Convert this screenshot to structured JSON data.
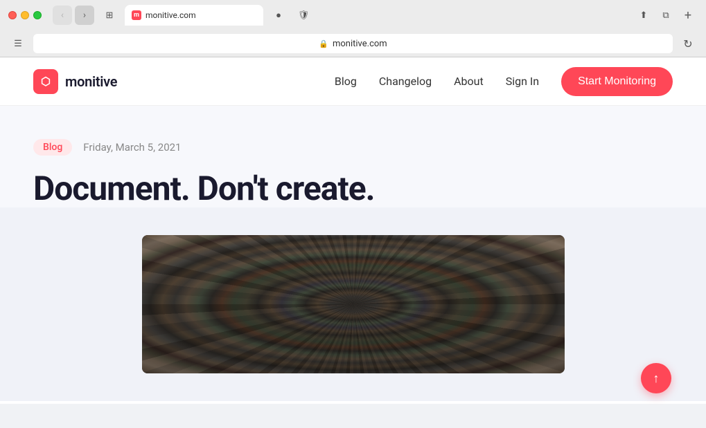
{
  "browser": {
    "url": "monitive.com",
    "tab_title": "monitive.com",
    "lock_char": "🔒",
    "refresh_char": "↻"
  },
  "nav": {
    "logo_text": "monitive",
    "logo_icon_text": "m",
    "links": [
      {
        "label": "Blog",
        "id": "nav-blog"
      },
      {
        "label": "Changelog",
        "id": "nav-changelog"
      },
      {
        "label": "About",
        "id": "nav-about"
      },
      {
        "label": "Sign In",
        "id": "nav-signin"
      }
    ],
    "cta_label": "Start Monitoring"
  },
  "blog": {
    "tag": "Blog",
    "date": "Friday, March 5, 2021",
    "title": "Document. Don't create."
  },
  "scroll_top": "↑",
  "colors": {
    "accent": "#ff4757",
    "tag_bg": "#ffe8ea",
    "tag_text": "#ff4757"
  }
}
